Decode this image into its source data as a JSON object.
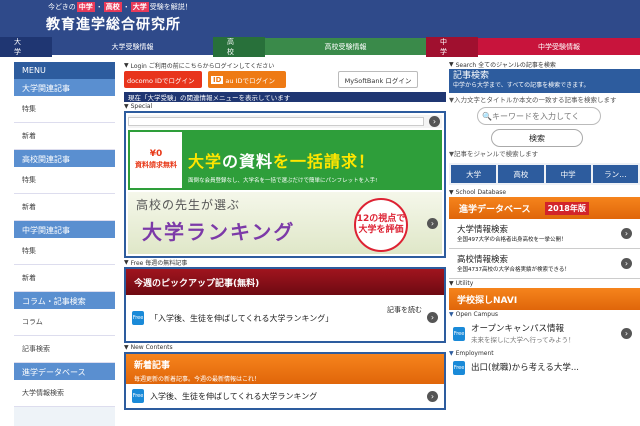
{
  "header": {
    "tagline_pre": "今どきの",
    "tag_junior": "中学",
    "tag_high": "高校",
    "tag_univ": "大学",
    "tagline_post": "受験を解説！",
    "site_title": "教育進学総合研究所"
  },
  "nav": [
    {
      "label": "大学",
      "sub": "大学受験情報"
    },
    {
      "label": "高校",
      "sub": "高校受験情報"
    },
    {
      "label": "中学",
      "sub": "中学受験情報"
    }
  ],
  "menu": {
    "title": "MENU",
    "groups": [
      {
        "label": "大学関連記事",
        "items": [
          "特集",
          "新着"
        ]
      },
      {
        "label": "高校関連記事",
        "items": [
          "特集",
          "新着"
        ]
      },
      {
        "label": "中学関連記事",
        "items": [
          "特集",
          "新着"
        ]
      },
      {
        "label": "コラム・記事検索",
        "items": [
          "コラム",
          "記事検索"
        ]
      },
      {
        "label": "進学データベース",
        "items": [
          "大学情報検索"
        ]
      }
    ]
  },
  "login": {
    "label": "Login ご利用の前にこちらからログインしてください",
    "docomo": "docomo IDでログイン",
    "au_badge": "ID",
    "au": "au IDでログイン",
    "softbank": "MySoftBank ログイン"
  },
  "notice": "現在「大学受験」の関連情報メニューを表示しています",
  "special": {
    "label": "Special",
    "banner1_zero": "資料請求無料",
    "banner1_yen": "¥0",
    "banner1_main_a": "大学",
    "banner1_main_b": "の資料",
    "banner1_main_c": "を一括請求！",
    "banner1_sub": "面倒な会員登録なし、大学名を一括で選ぶだけで簡単にパンフレットを入手!",
    "banner2_top": "高校の先生が選ぶ",
    "banner2_main": "大学ランキング",
    "banner2_circle": "12の視点で大学を評価"
  },
  "pickup": {
    "label": "Free 毎週の無料記事",
    "title": "今週のピックアップ記事(無料)",
    "free_badge": "Free",
    "item_text": "「入学後、生徒を伸ばしてくれる大学ランキング」",
    "read": "記事を読む"
  },
  "newc": {
    "label": "New Contents",
    "title": "新着記事",
    "sub": "毎週更新の新着記事。今週の最新情報はこれ！",
    "free_badge": "Free",
    "item_text": "入学後、生徒を伸ばしてくれる大学ランキング"
  },
  "search": {
    "label": "Search 全てのジャンルの記事を検索",
    "title": "記事検索",
    "sub": "中学から大学まで、すべての記事を検索できます。",
    "hint": "入力文字とタイトルか本文の一致する記事を検索します",
    "placeholder": "キーワードを入力してく",
    "button": "検索",
    "genre_label": "記事をジャンルで検索します",
    "genres": [
      "大学",
      "高校",
      "中学",
      "ラン…"
    ]
  },
  "db": {
    "label": "School Database",
    "title": "進学データベース",
    "year": "2018年版",
    "items": [
      {
        "title": "大学情報検索",
        "sub": "全国497大学の合格者出身高校を一挙公開！"
      },
      {
        "title": "高校情報検索",
        "sub": "全国4737高校の大学合格実績が検索できる！"
      }
    ]
  },
  "utility": {
    "label": "Utility",
    "navi": "学校探しNAVI"
  },
  "opencampus": {
    "label": "Open Campus",
    "free_badge": "Free",
    "title": "オープンキャンパス情報",
    "sub": "未来を探しに大学へ行ってみよう！"
  },
  "employment": {
    "label": "Employment",
    "free_badge": "Free",
    "title": "出口(就職)から考える大学..."
  }
}
